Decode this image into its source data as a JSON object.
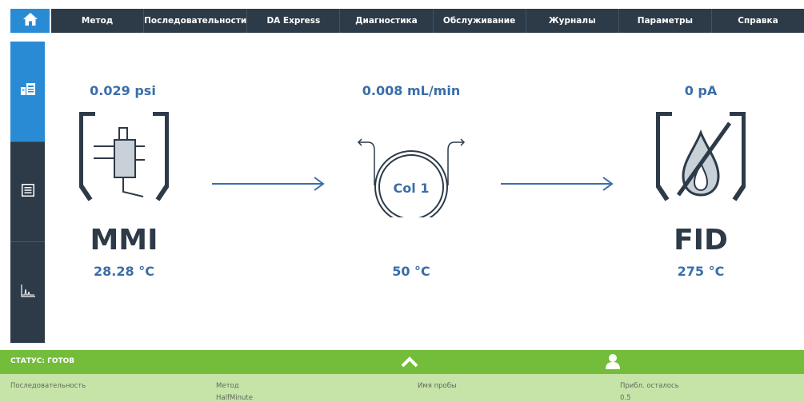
{
  "menu": {
    "items": [
      {
        "label": "Метод"
      },
      {
        "label": "Последовательности"
      },
      {
        "label": "DA Express"
      },
      {
        "label": "Диагностика"
      },
      {
        "label": "Обслуживание"
      },
      {
        "label": "Журналы"
      },
      {
        "label": "Параметры"
      },
      {
        "label": "Справка"
      }
    ]
  },
  "icons": {
    "home": "home-icon",
    "instrument": "instrument-status-icon",
    "list": "list-icon",
    "chromatogram": "chromatogram-icon",
    "expand": "chevron-up-icon",
    "user": "user-icon"
  },
  "colors": {
    "accent": "#2a8bd5",
    "nav_dark": "#2d3a48",
    "value_blue": "#3a6ea8",
    "status_green": "#74bd3b",
    "info_green": "#c6e4a8"
  },
  "inlet": {
    "pressure": "0.029 psi",
    "name": "MMI",
    "temperature": "28.28 °C"
  },
  "column": {
    "flow": "0.008 mL/min",
    "label": "Col 1",
    "temperature": "50 °C"
  },
  "detector": {
    "signal": "0 pA",
    "name": "FID",
    "temperature": "275 °C"
  },
  "status": {
    "text": "СТАТУС: ГОТОВ"
  },
  "info": {
    "sequence_label": "Последовательность",
    "method_label": "Метод",
    "method_value": "HalfMinute",
    "sample_label": "Имя пробы",
    "remaining_label": "Прибл. осталось",
    "remaining_value": "0.5"
  }
}
